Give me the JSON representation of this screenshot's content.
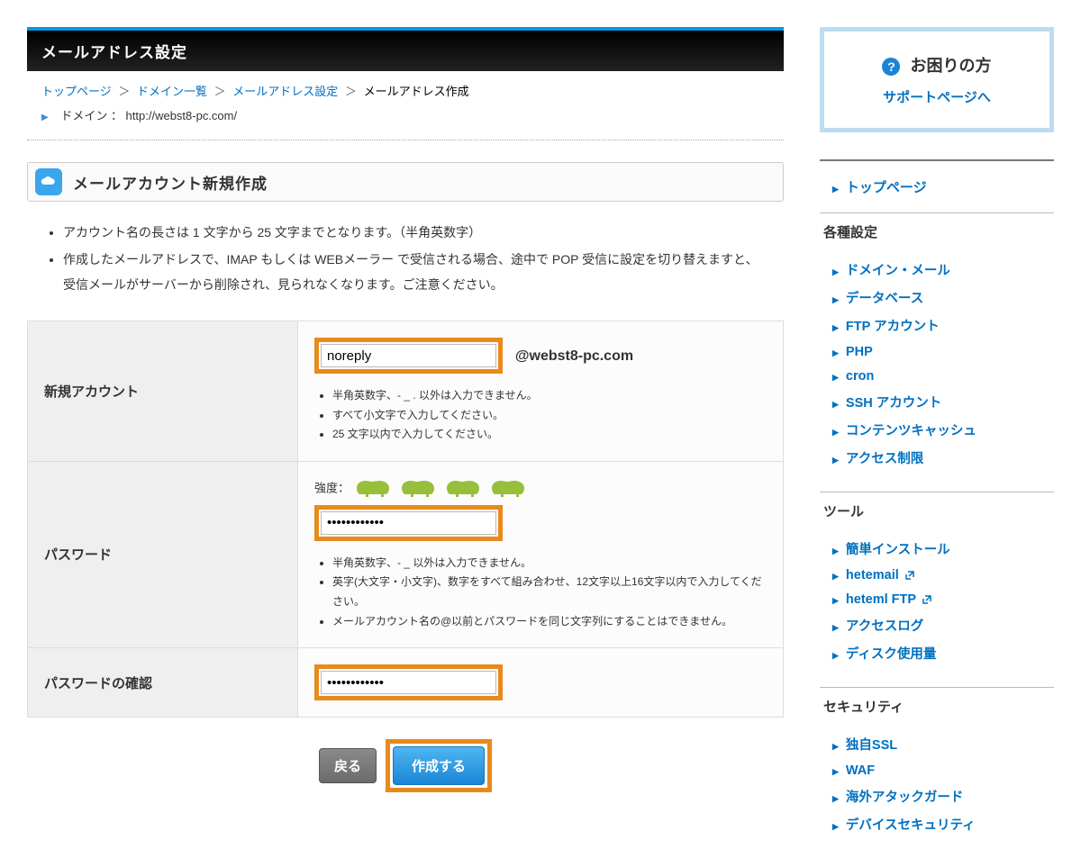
{
  "page": {
    "title": "メールアドレス設定",
    "breadcrumbs": {
      "top": "トップページ",
      "domains": "ドメイン一覧",
      "mail_settings": "メールアドレス設定",
      "current": "メールアドレス作成"
    },
    "domain_label": "ドメイン  ：  http://webst8-pc.com/"
  },
  "section": {
    "title": "メールアカウント新規作成"
  },
  "info_notes": [
    "アカウント名の長さは 1 文字から 25 文字までとなります。（半角英数字）",
    "作成したメールアドレスで、IMAP もしくは WEBメーラー で受信される場合、途中で POP 受信に設定を切り替えますと、受信メールがサーバーから削除され、見られなくなります。ご注意ください。"
  ],
  "form": {
    "account": {
      "label": "新規アカウント",
      "value": "noreply",
      "domain": "@webst8-pc.com",
      "notes": [
        "半角英数字、- _ . 以外は入力できません。",
        "すべて小文字で入力してください。",
        "25 文字以内で入力してください。"
      ]
    },
    "password": {
      "label": "パスワード",
      "strength_label": "強度：",
      "value": "************",
      "notes": [
        "半角英数字、- _ 以外は入力できません。",
        "英字(大文字・小文字)、数字をすべて組み合わせ、12文字以上16文字以内で入力してください。",
        "メールアカウント名の@以前とパスワードを同じ文字列にすることはできません。"
      ]
    },
    "password_confirm": {
      "label": "パスワードの確認",
      "value": "************"
    }
  },
  "buttons": {
    "back": "戻る",
    "submit": "作成する"
  },
  "help": {
    "title": "お困りの方",
    "link": "サポートページへ"
  },
  "sidebar": {
    "top": "トップページ",
    "groups": [
      {
        "title": "各種設定",
        "items": [
          {
            "label": "ドメイン・メール"
          },
          {
            "label": "データベース"
          },
          {
            "label": "FTP アカウント"
          },
          {
            "label": "PHP"
          },
          {
            "label": "cron"
          },
          {
            "label": "SSH アカウント"
          },
          {
            "label": "コンテンツキャッシュ"
          },
          {
            "label": "アクセス制限"
          }
        ]
      },
      {
        "title": "ツール",
        "items": [
          {
            "label": "簡単インストール"
          },
          {
            "label": "hetemail",
            "external": true
          },
          {
            "label": "heteml FTP",
            "external": true
          },
          {
            "label": "アクセスログ"
          },
          {
            "label": "ディスク使用量"
          }
        ]
      },
      {
        "title": "セキュリティ",
        "items": [
          {
            "label": "独自SSL"
          },
          {
            "label": "WAF"
          },
          {
            "label": "海外アタックガード"
          },
          {
            "label": "デバイスセキュリティ"
          }
        ]
      }
    ]
  }
}
